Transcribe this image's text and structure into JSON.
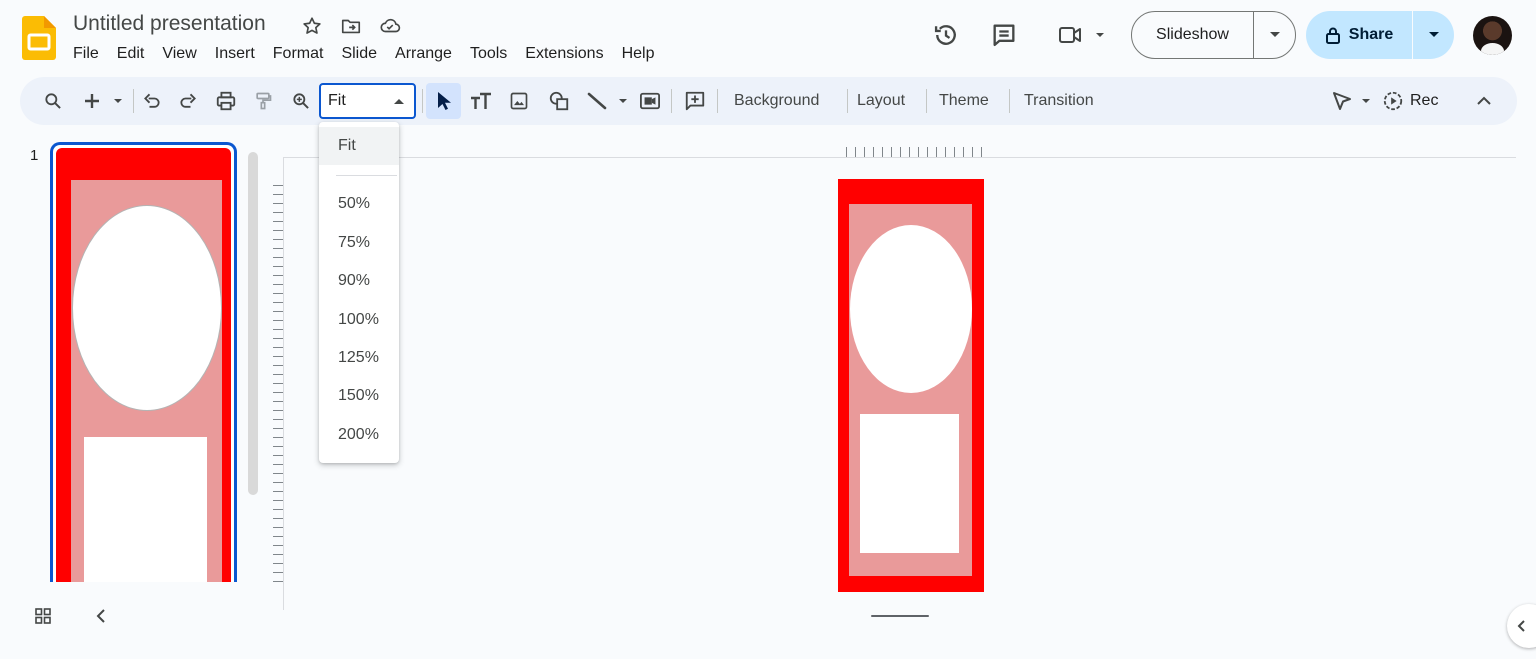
{
  "app": {
    "title": "Untitled presentation",
    "menus": [
      "File",
      "Edit",
      "View",
      "Insert",
      "Format",
      "Slide",
      "Arrange",
      "Tools",
      "Extensions",
      "Help"
    ]
  },
  "header": {
    "slideshow_label": "Slideshow",
    "share_label": "Share"
  },
  "toolbar": {
    "zoom_value": "Fit",
    "background_label": "Background",
    "layout_label": "Layout",
    "theme_label": "Theme",
    "transition_label": "Transition",
    "rec_label": "Rec"
  },
  "zoom_menu": {
    "options": [
      "Fit",
      "50%",
      "75%",
      "90%",
      "100%",
      "125%",
      "150%",
      "200%"
    ],
    "selected": "Fit"
  },
  "filmstrip": {
    "slide_number": "1"
  },
  "colors": {
    "accent": "#0b57d0",
    "share_bg": "#c2e7ff",
    "toolbar_bg": "#edf2fa",
    "slide_red": "#ff0000",
    "slide_pink": "#e99a9a"
  }
}
